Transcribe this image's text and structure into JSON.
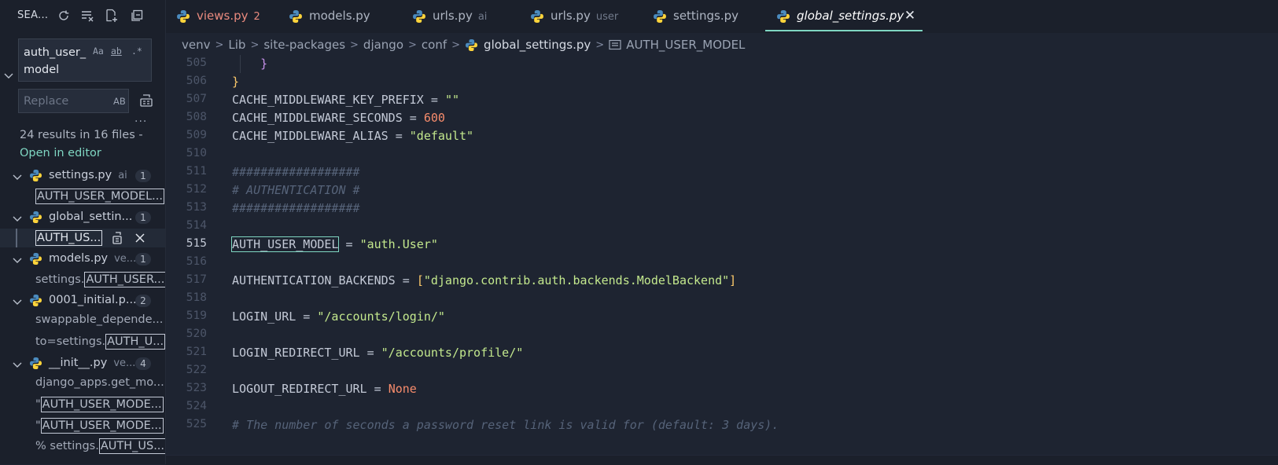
{
  "sidebar": {
    "title": "SEA...",
    "search": {
      "value": "auth_user_\nmodel",
      "options": [
        "Aa",
        "ab",
        ".*"
      ]
    },
    "replace": {
      "placeholder": "Replace",
      "option": "AB"
    },
    "more": "...",
    "summary": "24 results in 16 files -",
    "open_in_editor": "Open in editor",
    "files": [
      {
        "name": "settings.py",
        "dir": "ai",
        "count": "1",
        "matches": [
          {
            "pre": "",
            "hit": "AUTH_USER_MODEL..."
          }
        ]
      },
      {
        "name": "global_settin...",
        "dir": "",
        "count": "1",
        "matches": [
          {
            "pre": "",
            "hit": "AUTH_US..."
          }
        ]
      },
      {
        "name": "models.py",
        "dir": "ve...",
        "count": "1",
        "matches": [
          {
            "pre": "settings.",
            "hit": "AUTH_USER..."
          }
        ]
      },
      {
        "name": "0001_initial.p...",
        "dir": "",
        "count": "2",
        "matches": [
          {
            "pre": "swappable_depende...",
            "hit": ""
          },
          {
            "pre": "to=settings.",
            "hit": "AUTH_U..."
          }
        ]
      },
      {
        "name": "__init__.py",
        "dir": "ve...",
        "count": "4",
        "matches": [
          {
            "pre": "django_apps.get_mo...",
            "hit": ""
          },
          {
            "pre": "\"",
            "hit": "AUTH_USER_MODE..."
          },
          {
            "pre": "\"",
            "hit": "AUTH_USER_MODE..."
          },
          {
            "pre": "% settings.",
            "hit": "AUTH_US..."
          }
        ]
      }
    ]
  },
  "tabs": [
    {
      "label": "views.py",
      "desc": "2",
      "state": "modified"
    },
    {
      "label": "models.py",
      "desc": "",
      "state": ""
    },
    {
      "label": "urls.py",
      "desc": "ai",
      "state": ""
    },
    {
      "label": "urls.py",
      "desc": "user",
      "state": ""
    },
    {
      "label": "settings.py",
      "desc": "",
      "state": ""
    },
    {
      "label": "global_settings.py",
      "desc": "",
      "state": "active"
    }
  ],
  "breadcrumb": [
    "venv",
    "Lib",
    "site-packages",
    "django",
    "conf",
    "global_settings.py",
    "AUTH_USER_MODEL"
  ],
  "editor": {
    "current_line": "515",
    "lines": [
      {
        "n": "505",
        "t": [
          "brk-p",
          "    }"
        ]
      },
      {
        "n": "506",
        "t": [
          "brk-y",
          "}"
        ]
      },
      {
        "n": "507",
        "t": [
          "op",
          "CACHE_MIDDLEWARE_KEY_PREFIX = "
        ],
        "s": "\"\""
      },
      {
        "n": "508",
        "t": [
          "op",
          "CACHE_MIDDLEWARE_SECONDS = "
        ],
        "num": "600"
      },
      {
        "n": "509",
        "t": [
          "op",
          "CACHE_MIDDLEWARE_ALIAS = "
        ],
        "s": "\"default\""
      },
      {
        "n": "510"
      },
      {
        "n": "511",
        "c": "##################"
      },
      {
        "n": "512",
        "c": "# AUTHENTICATION #"
      },
      {
        "n": "513",
        "c": "##################"
      },
      {
        "n": "514"
      },
      {
        "n": "515",
        "m": "AUTH_USER_MODEL",
        "t": [
          "op",
          " = "
        ],
        "s": "\"auth.User\""
      },
      {
        "n": "516"
      },
      {
        "n": "517",
        "t": [
          "op",
          "AUTHENTICATION_BACKENDS = "
        ],
        "b1": "[",
        "s": "\"django.contrib.auth.backends.ModelBackend\"",
        "b2": "]"
      },
      {
        "n": "518"
      },
      {
        "n": "519",
        "t": [
          "op",
          "LOGIN_URL = "
        ],
        "s": "\"/accounts/login/\""
      },
      {
        "n": "520"
      },
      {
        "n": "521",
        "t": [
          "op",
          "LOGIN_REDIRECT_URL = "
        ],
        "s": "\"/accounts/profile/\""
      },
      {
        "n": "522"
      },
      {
        "n": "523",
        "t": [
          "op",
          "LOGOUT_REDIRECT_URL = "
        ],
        "k": "None"
      },
      {
        "n": "524"
      },
      {
        "n": "525",
        "c": "# The number of seconds a password reset link is valid for (default: 3 days)."
      }
    ]
  },
  "colors": {
    "accent": "#7fd6c2",
    "string": "#c3e88d",
    "number": "#f78c6c",
    "comment": "#566379",
    "modified_tab": "#e98a7e"
  },
  "icons": [
    "refresh-icon",
    "clear-results-icon",
    "new-search-editor-icon",
    "collapse-all-icon",
    "chevron-down-icon",
    "python-file-icon",
    "replace-all-icon",
    "close-icon",
    "symbol-field-icon"
  ]
}
